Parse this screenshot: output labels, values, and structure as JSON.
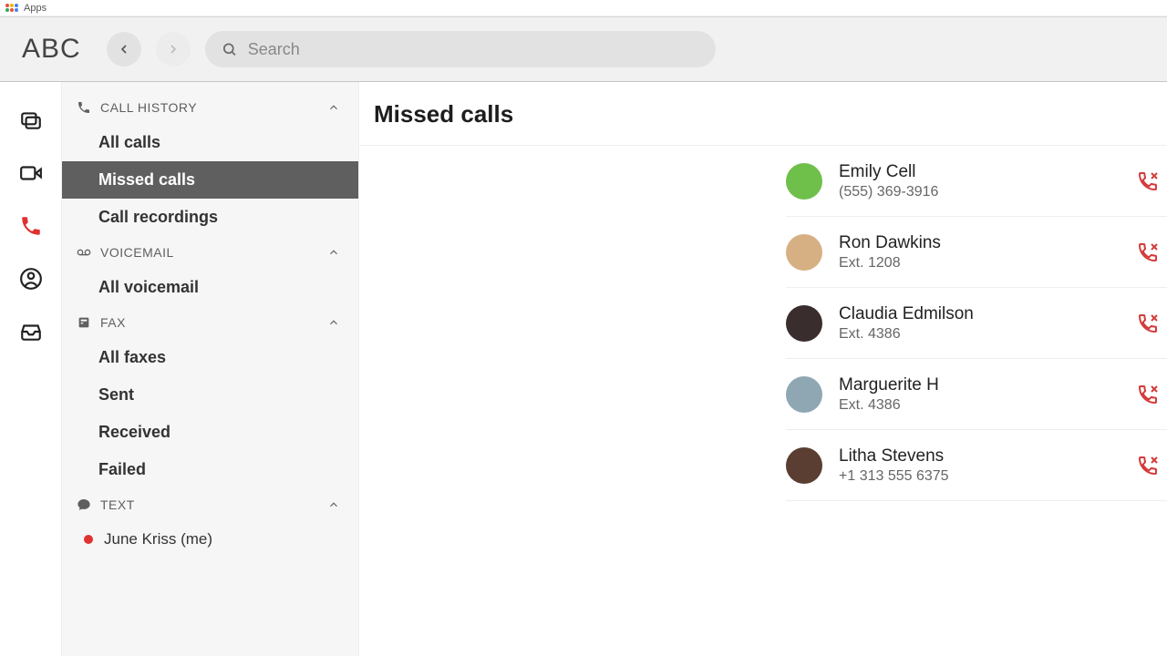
{
  "appbar": {
    "label": "Apps"
  },
  "header": {
    "brand": "ABC",
    "search_placeholder": "Search"
  },
  "sidebar": {
    "sections": {
      "call_history": {
        "label": "CALL HISTORY",
        "items": [
          {
            "label": "All calls"
          },
          {
            "label": "Missed calls",
            "selected": true
          },
          {
            "label": "Call recordings"
          }
        ]
      },
      "voicemail": {
        "label": "VOICEMAIL",
        "items": [
          {
            "label": "All voicemail"
          }
        ]
      },
      "fax": {
        "label": "FAX",
        "items": [
          {
            "label": "All faxes"
          },
          {
            "label": "Sent"
          },
          {
            "label": "Received"
          },
          {
            "label": "Failed"
          }
        ]
      },
      "text": {
        "label": "TEXT"
      }
    },
    "user": {
      "name": "June Kriss (me)",
      "status": "busy"
    }
  },
  "content": {
    "title": "Missed calls",
    "calls": [
      {
        "name": "Emily Cell",
        "detail": "(555) 369-3916",
        "avatar": "av1"
      },
      {
        "name": "Ron Dawkins",
        "detail": "Ext. 1208",
        "avatar": "av2"
      },
      {
        "name": "Claudia Edmilson",
        "detail": "Ext. 4386",
        "avatar": "av3"
      },
      {
        "name": "Marguerite H",
        "detail": "Ext. 4386",
        "avatar": "av4"
      },
      {
        "name": "Litha Stevens",
        "detail": "+1 313 555 6375",
        "avatar": "av5"
      }
    ]
  }
}
